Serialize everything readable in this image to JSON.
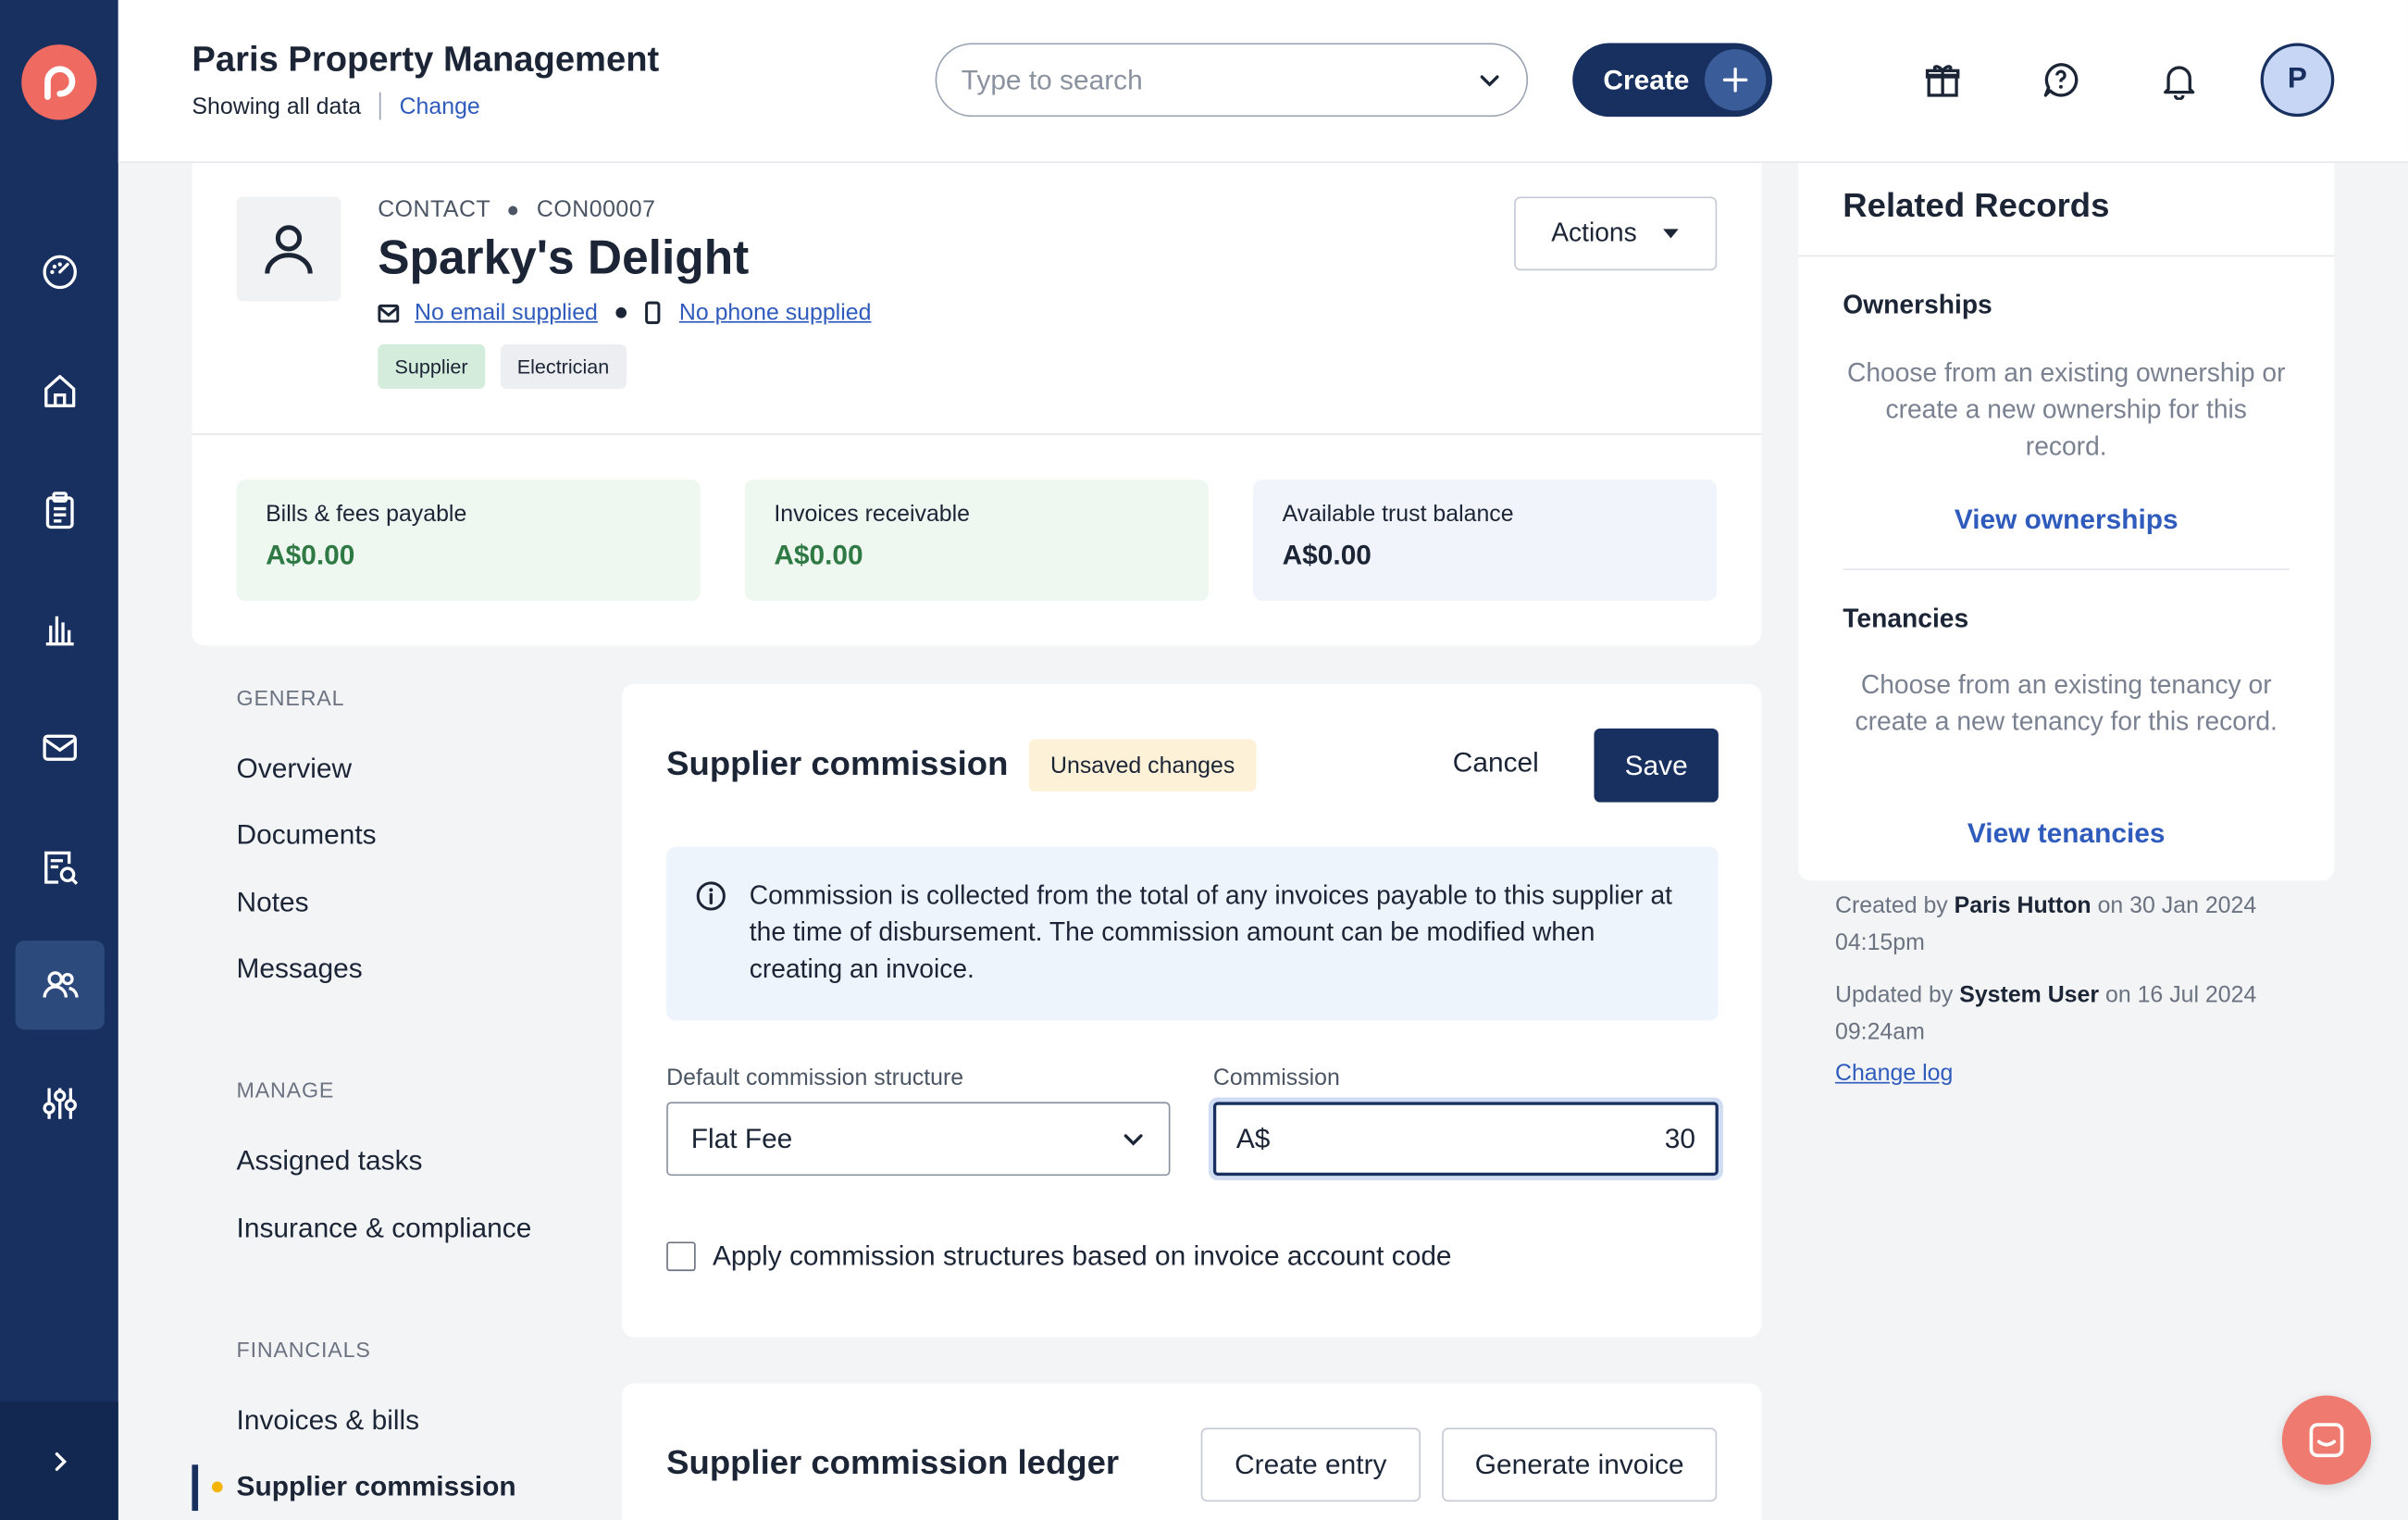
{
  "header": {
    "org_name": "Paris Property Management",
    "showing": "Showing all data",
    "change_link": "Change",
    "search_placeholder": "Type to search",
    "create_label": "Create",
    "avatar_initial": "P"
  },
  "contact": {
    "kicker_type": "CONTACT",
    "kicker_id": "CON00007",
    "name": "Sparky's Delight",
    "email_link": "No email supplied",
    "phone_link": "No phone supplied",
    "tags": [
      "Supplier",
      "Electrician"
    ],
    "actions_label": "Actions"
  },
  "stats": [
    {
      "label": "Bills & fees payable",
      "value": "A$0.00"
    },
    {
      "label": "Invoices receivable",
      "value": "A$0.00"
    },
    {
      "label": "Available trust balance",
      "value": "A$0.00"
    }
  ],
  "nav": {
    "general_heading": "GENERAL",
    "general": [
      "Overview",
      "Documents",
      "Notes",
      "Messages"
    ],
    "manage_heading": "MANAGE",
    "manage": [
      "Assigned tasks",
      "Insurance & compliance"
    ],
    "financials_heading": "FINANCIALS",
    "financials": [
      "Invoices & bills",
      "Supplier commission"
    ]
  },
  "commission": {
    "title": "Supplier commission",
    "badge": "Unsaved changes",
    "cancel": "Cancel",
    "save": "Save",
    "info": "Commission is collected from the total of any invoices payable to this supplier at the time of disbursement. The commission amount can be modified when creating an invoice.",
    "structure_label": "Default commission structure",
    "structure_value": "Flat Fee",
    "commission_label": "Commission",
    "currency_prefix": "A$",
    "commission_value": "30",
    "checkbox_label": "Apply commission structures based on invoice account code"
  },
  "ledger": {
    "title": "Supplier commission ledger",
    "create_entry": "Create entry",
    "generate_invoice": "Generate invoice"
  },
  "related": {
    "title": "Related Records",
    "ownerships_heading": "Ownerships",
    "ownerships_text": "Choose from an existing ownership or create a new ownership for this record.",
    "ownerships_link": "View ownerships",
    "tenancies_heading": "Tenancies",
    "tenancies_text": "Choose from an existing tenancy or create a new tenancy for this record.",
    "tenancies_link": "View tenancies"
  },
  "meta": {
    "created_prefix": "Created by",
    "created_by": "Paris Hutton",
    "created_on": "on 30 Jan 2024 04:15pm",
    "updated_prefix": "Updated by",
    "updated_by": "System User",
    "updated_on": "on 16 Jul 2024 09:24am",
    "change_log": "Change log"
  },
  "icons": {
    "rail": [
      "dashboard-icon",
      "home-icon",
      "clipboard-icon",
      "reports-icon",
      "mail-icon",
      "search-document-icon",
      "contacts-icon",
      "settings-sliders-icon"
    ],
    "top": [
      "gift-icon",
      "help-icon",
      "bell-icon"
    ]
  },
  "colors": {
    "navy": "#17305f",
    "brand_coral": "#ef6b62",
    "link": "#2f5bbd",
    "positive": "#2f7a44"
  }
}
